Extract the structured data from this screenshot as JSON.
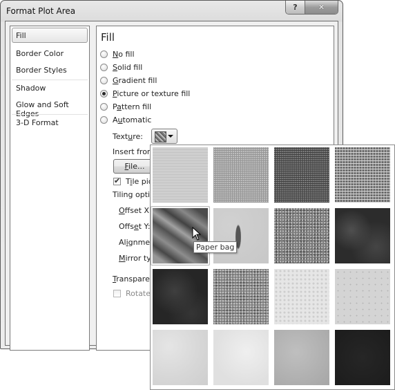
{
  "window": {
    "title": "Format Plot Area",
    "help_label": "?",
    "close_label": "✕"
  },
  "nav": {
    "items": [
      {
        "label": "Fill",
        "selected": true
      },
      {
        "label": "Border Color"
      },
      {
        "label": "Border Styles"
      },
      {
        "label": "Shadow"
      },
      {
        "label": "Glow and Soft Edges"
      },
      {
        "label": "3-D Format"
      }
    ]
  },
  "panel": {
    "title": "Fill",
    "fill_options": [
      {
        "key": "N",
        "rest": "o fill",
        "selected": false
      },
      {
        "key": "S",
        "rest": "olid fill",
        "selected": false
      },
      {
        "key": "G",
        "rest": "radient fill",
        "selected": false
      },
      {
        "key": "P",
        "rest": "icture or texture fill",
        "selected": true
      },
      {
        "pre": "P",
        "key": "a",
        "rest": "ttern fill",
        "selected": false
      },
      {
        "pre": "A",
        "key": "u",
        "rest": "tomatic",
        "selected": false
      }
    ],
    "texture_label_pre": "Text",
    "texture_label_key": "u",
    "texture_label_post": "re:",
    "insert_from": "Insert from",
    "file_key": "F",
    "file_rest": "ile...",
    "tile_picture_pre": "T",
    "tile_picture_key": "i",
    "tile_picture_post": "le pict",
    "tile_checked": true,
    "tiling_options": "Tiling optio",
    "offset_x_key": "O",
    "offset_x_rest": "ffset X:",
    "offset_y_pre": "Offs",
    "offset_y_key": "e",
    "offset_y_rest": "t Y:",
    "alignment_pre": "Al",
    "alignment_key": "i",
    "alignment_rest": "gnmen",
    "mirror_key": "M",
    "mirror_rest": "irror typ",
    "transparency_key": "T",
    "transparency_rest": "ransparer",
    "rotate_label": "Rotate",
    "rotate_checked": false
  },
  "gallery": {
    "hovered_tooltip": "Paper bag",
    "tiles": [
      {
        "name": "texture-1",
        "tone": "#cfcfcf",
        "style": "linen"
      },
      {
        "name": "texture-2",
        "tone": "#bdbdbd",
        "style": "canvas"
      },
      {
        "name": "texture-3",
        "tone": "#5e5e5e",
        "style": "denim"
      },
      {
        "name": "texture-4",
        "tone": "#9a9a9a",
        "style": "woven"
      },
      {
        "name": "Paper bag",
        "tone": "#6f6f6f",
        "style": "crumpled",
        "hovered": true
      },
      {
        "name": "texture-6",
        "tone": "#c7c7c7",
        "style": "fish-fossil"
      },
      {
        "name": "texture-7",
        "tone": "#7d7d7d",
        "style": "speckled"
      },
      {
        "name": "texture-8",
        "tone": "#2c2c2c",
        "style": "dark-cloud"
      },
      {
        "name": "texture-9",
        "tone": "#262626",
        "style": "dark-marble"
      },
      {
        "name": "texture-10",
        "tone": "#7a7a7a",
        "style": "granite"
      },
      {
        "name": "texture-11",
        "tone": "#e6e6e6",
        "style": "white-marble"
      },
      {
        "name": "texture-12",
        "tone": "#d4d4d4",
        "style": "sand"
      },
      {
        "name": "texture-13",
        "tone": "#d6d6d6",
        "style": "parchment"
      },
      {
        "name": "texture-14",
        "tone": "#e0e0e0",
        "style": "stationery"
      },
      {
        "name": "texture-15",
        "tone": "#b0b0b0",
        "style": "recycled"
      },
      {
        "name": "texture-16",
        "tone": "#1c1c1c",
        "style": "black"
      }
    ]
  }
}
